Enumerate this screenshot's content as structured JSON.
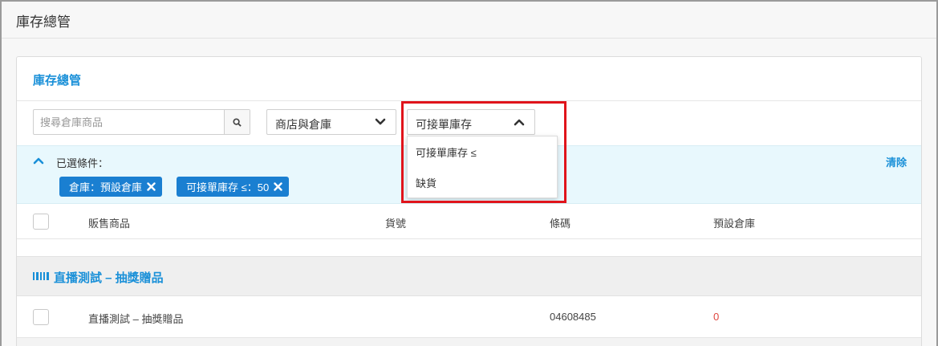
{
  "page": {
    "title": "庫存總管"
  },
  "panel": {
    "title": "庫存總管"
  },
  "search": {
    "placeholder": "搜尋倉庫商品"
  },
  "filters": {
    "store_select": "商店與倉庫",
    "stock_select": "可接單庫存",
    "selected_label": "已選條件：",
    "clear_label": "清除",
    "chips": [
      {
        "label": "倉庫：預設倉庫"
      },
      {
        "label": "可接單庫存 ≤：50"
      }
    ]
  },
  "dropdown": {
    "items": [
      {
        "label": "可接單庫存 ≤"
      },
      {
        "label": "缺貨"
      }
    ]
  },
  "table": {
    "columns": [
      "販售商品",
      "貨號",
      "條碼",
      "預設倉庫"
    ],
    "group": {
      "title": "直播測試 – 抽獎贈品"
    },
    "rows": [
      {
        "product": "直播測試 – 抽獎贈品",
        "sku": "",
        "barcode": "04608485",
        "default_warehouse": "0"
      }
    ]
  },
  "colors": {
    "accent": "#1a90d8",
    "chip": "#1a7fd1",
    "alert": "#e0463f",
    "highlight_box": "#e0141b"
  }
}
